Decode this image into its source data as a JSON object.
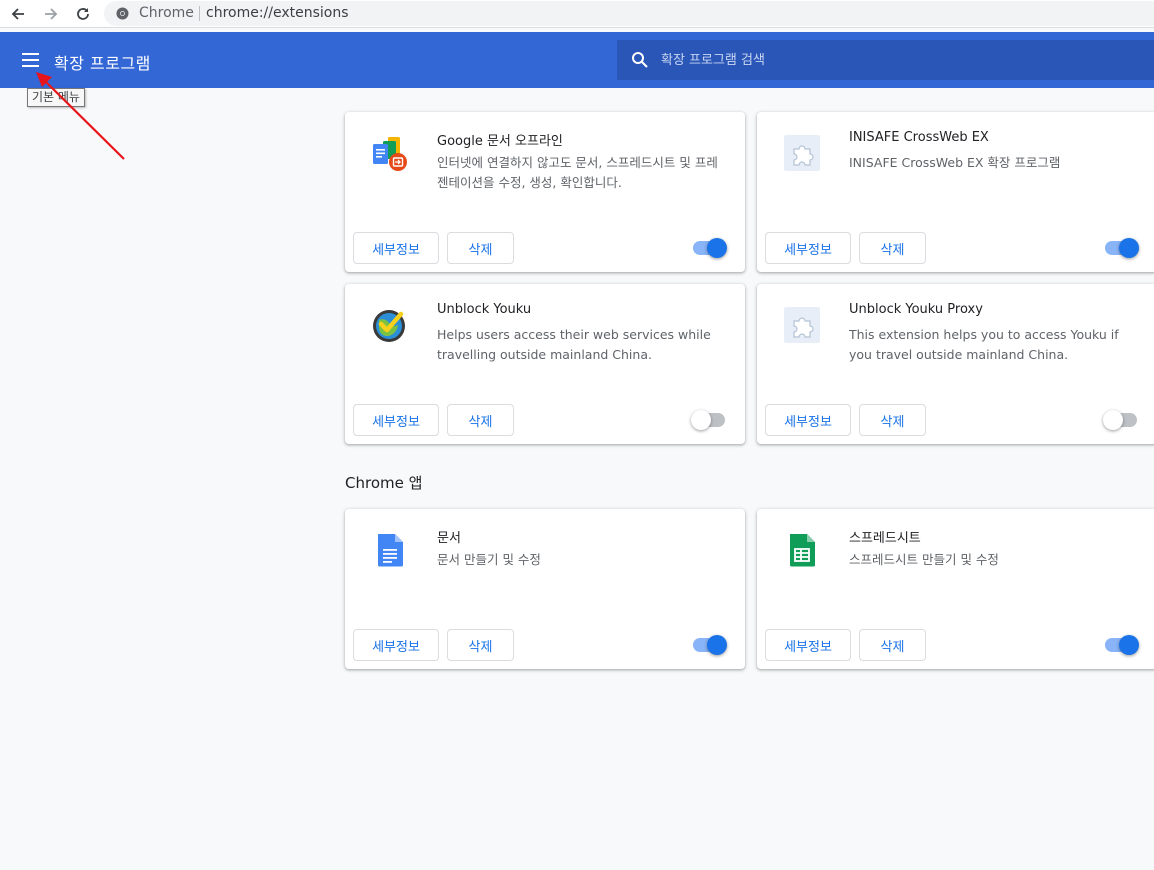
{
  "browser": {
    "site_label": "Chrome",
    "url": "chrome://extensions"
  },
  "header": {
    "title": "확장 프로그램",
    "search_placeholder": "확장 프로그램 검색",
    "menu_tooltip": "기본 메뉴"
  },
  "colors": {
    "header_bg": "#3367d6",
    "accent": "#1a73e8",
    "page_bg": "#f8f9fa"
  },
  "extensions": [
    {
      "name": "Google 문서 오프라인",
      "description": "인터넷에 연결하지 않고도 문서, 스프레드시트 및 프레젠테이션을 수정, 생성, 확인합니다.",
      "details_label": "세부정보",
      "remove_label": "삭제",
      "enabled": true,
      "icon": "google-docs-offline-icon"
    },
    {
      "name": "INISAFE CrossWeb EX",
      "description": "INISAFE CrossWeb EX 확장 프로그램",
      "details_label": "세부정보",
      "remove_label": "삭제",
      "enabled": true,
      "icon": "puzzle-icon"
    },
    {
      "name": "Unblock Youku",
      "description": "Helps users access their web services while travelling outside mainland China.",
      "details_label": "세부정보",
      "remove_label": "삭제",
      "enabled": false,
      "icon": "unblock-youku-icon"
    },
    {
      "name": "Unblock Youku Proxy",
      "description": "This extension helps you to access Youku if you travel outside mainland China.",
      "details_label": "세부정보",
      "remove_label": "삭제",
      "enabled": false,
      "icon": "puzzle-icon"
    }
  ],
  "apps_section": {
    "title": "Chrome 앱",
    "apps": [
      {
        "name": "문서",
        "description": "문서 만들기 및 수정",
        "details_label": "세부정보",
        "remove_label": "삭제",
        "enabled": true,
        "icon": "docs-icon"
      },
      {
        "name": "스프레드시트",
        "description": "스프레드시트 만들기 및 수정",
        "details_label": "세부정보",
        "remove_label": "삭제",
        "enabled": true,
        "icon": "sheets-icon"
      }
    ]
  }
}
